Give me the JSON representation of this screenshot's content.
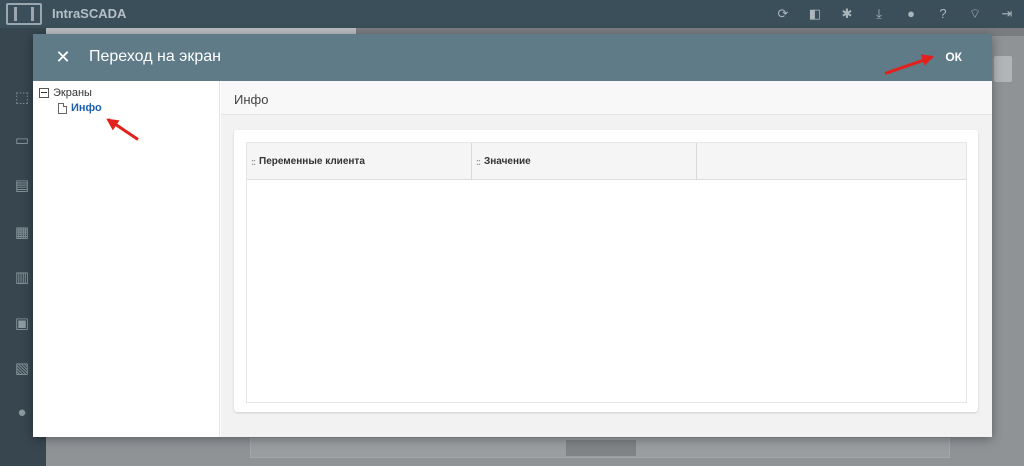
{
  "app": {
    "title": "IntraSCADA",
    "toolbar_icons": [
      "refresh-icon",
      "screen-icon",
      "settings-icon",
      "download-icon",
      "bug-icon",
      "help-icon",
      "wifi-icon",
      "logout-icon"
    ],
    "sidebar_icons": [
      "objects-icon",
      "screens-icon",
      "reports-icon",
      "modules-icon",
      "charts-icon",
      "database-icon",
      "journal-icon",
      "user-icon"
    ]
  },
  "dialog": {
    "title": "Переход на экран",
    "ok_label": "ОК",
    "close_glyph": "✕",
    "tree": {
      "root_label": "Экраны",
      "items": [
        {
          "label": "Инфо",
          "selected": true
        }
      ]
    },
    "content": {
      "title": "Инфо",
      "columns": [
        "Переменные клиента",
        "Значение"
      ]
    }
  },
  "colors": {
    "header": "#5e7b87",
    "selected_link": "#1f5fa8",
    "annotation_arrow": "#e3211c"
  }
}
